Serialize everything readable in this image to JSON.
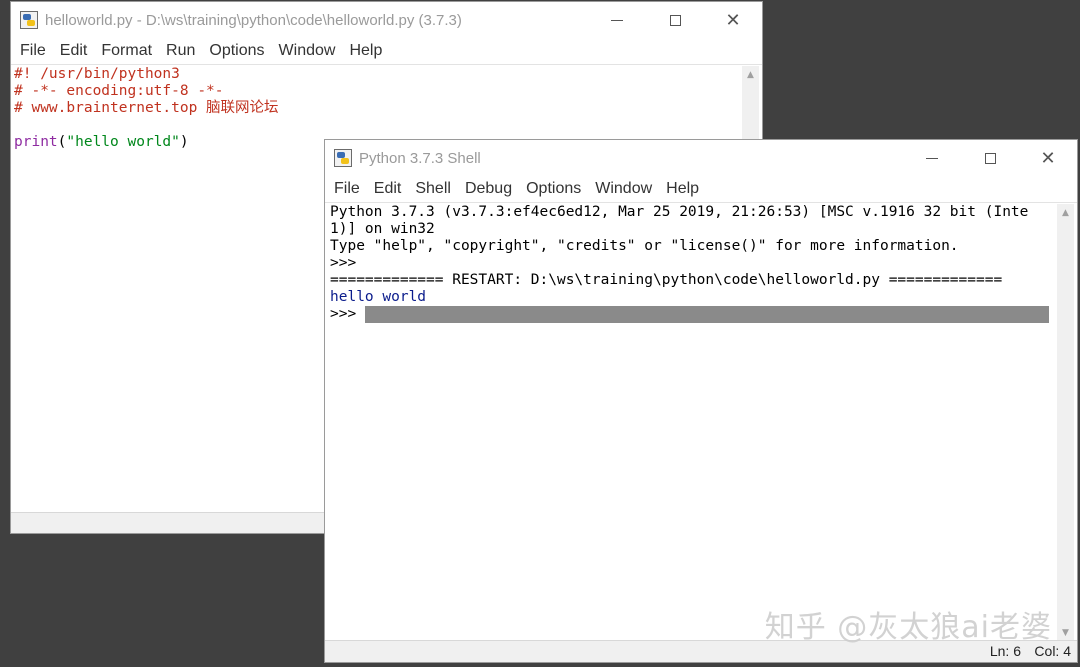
{
  "editor_window": {
    "title": "helloworld.py - D:\\ws\\training\\python\\code\\helloworld.py (3.7.3)",
    "menu": [
      "File",
      "Edit",
      "Format",
      "Run",
      "Options",
      "Window",
      "Help"
    ],
    "code": {
      "line1": "#! /usr/bin/python3",
      "line2": "# -*- encoding:utf-8 -*-",
      "line3": "# www.brainternet.top 脑联网论坛",
      "line5_builtin": "print",
      "line5_open": "(",
      "line5_string": "\"hello world\"",
      "line5_close": ")"
    }
  },
  "shell_window": {
    "title": "Python 3.7.3 Shell",
    "menu": [
      "File",
      "Edit",
      "Shell",
      "Debug",
      "Options",
      "Window",
      "Help"
    ],
    "output": {
      "banner1": "Python 3.7.3 (v3.7.3:ef4ec6ed12, Mar 25 2019, 21:26:53) [MSC v.1916 32 bit (Inte",
      "banner2": "1)] on win32",
      "banner3": "Type \"help\", \"copyright\", \"credits\" or \"license()\" for more information.",
      "prompt1": ">>> ",
      "restart": "============= RESTART: D:\\ws\\training\\python\\code\\helloworld.py =============",
      "stdout": "hello world",
      "prompt2": ">>> "
    },
    "status": {
      "ln": "Ln: 6",
      "col": "Col: 4"
    }
  },
  "watermark": "知乎 @灰太狼ai老婆",
  "icons": {
    "minimize": "minimize-icon",
    "maximize": "maximize-icon",
    "close": "close-icon",
    "close_glyph": "✕",
    "scroll_up": "▲",
    "scroll_down": "▼"
  }
}
